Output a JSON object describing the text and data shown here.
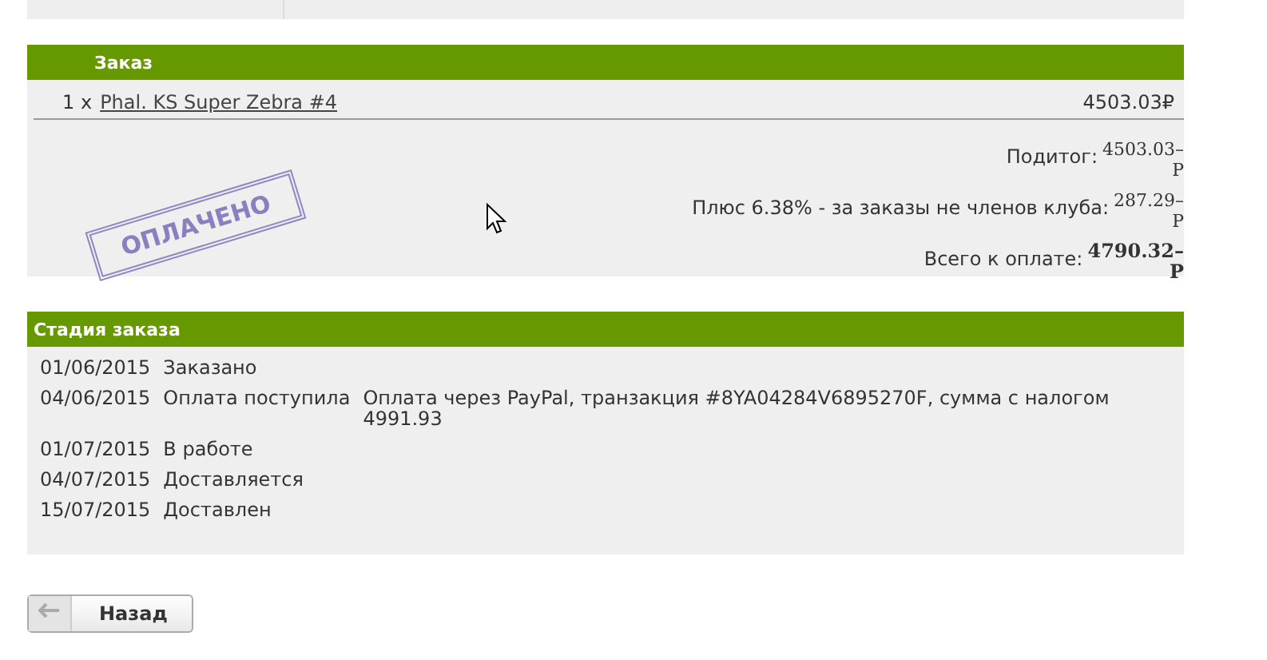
{
  "order": {
    "title": "Заказ",
    "items": [
      {
        "qty": "1 x",
        "name": "Phal. KS Super Zebra #4",
        "price": "4503.03₽"
      }
    ],
    "stamp": "ОПЛАЧЕНО",
    "totals": [
      {
        "label": "Подитог:",
        "amount": "4503.03–",
        "currency": "Р",
        "bold": false
      },
      {
        "label": "Плюс 6.38% - за заказы не членов клуба:",
        "amount": "287.29–",
        "currency": "Р",
        "bold": false
      },
      {
        "label": "Всего к оплате:",
        "amount": "4790.32–",
        "currency": "Р",
        "bold": true
      }
    ]
  },
  "stages": {
    "title": "Стадия заказа",
    "rows": [
      {
        "date": "01/06/2015",
        "status": "Заказано"
      },
      {
        "date": "04/06/2015",
        "status": "Оплата поступила",
        "note": "Оплата через PayPal, транзакция #8YA04284V6895270F, сумма с налогом 4991.93"
      },
      {
        "date": "01/07/2015",
        "status": "В работе"
      },
      {
        "date": "04/07/2015",
        "status": "Доставляется"
      },
      {
        "date": "15/07/2015",
        "status": "Доставлен"
      }
    ]
  },
  "back_button": "Назад"
}
